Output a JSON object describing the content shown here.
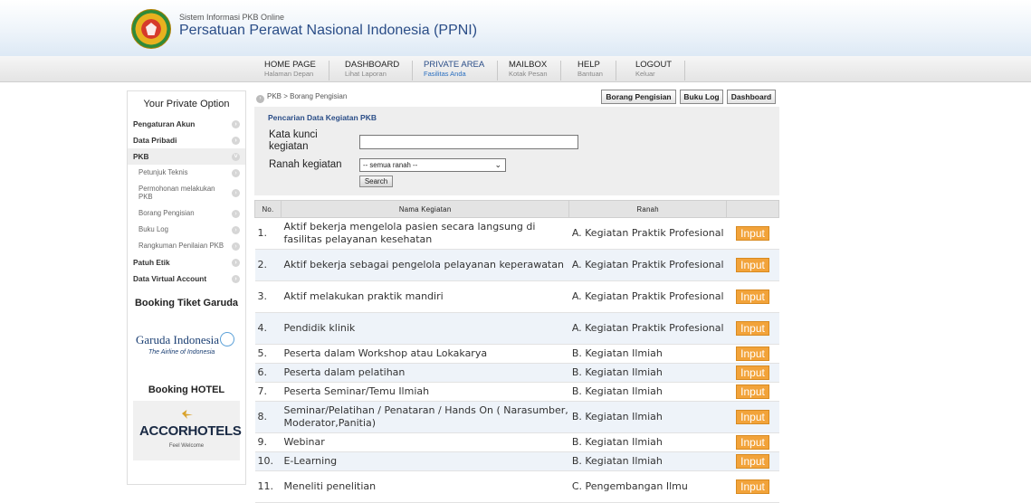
{
  "site": {
    "subtitle": "Sistem Informasi PKB Online",
    "title": "Persatuan Perawat Nasional Indonesia (PPNI)"
  },
  "nav": [
    {
      "label": "HOME PAGE",
      "sub": "Halaman Depan"
    },
    {
      "label": "DASHBOARD",
      "sub": "Lihat Laporan"
    },
    {
      "label": "PRIVATE AREA",
      "sub": "Fasilitas Anda",
      "active": true
    },
    {
      "label": "MAILBOX",
      "sub": "Kotak Pesan"
    },
    {
      "label": "HELP",
      "sub": "Bantuan"
    },
    {
      "label": "LOGOUT",
      "sub": "Keluar"
    }
  ],
  "sidebar": {
    "title": "Your Private Option",
    "items": [
      {
        "label": "Pengaturan Akun"
      },
      {
        "label": "Data Pribadi"
      },
      {
        "label": "PKB"
      },
      {
        "label": "Petunjuk Teknis"
      },
      {
        "label": "Permohonan melakukan PKB"
      },
      {
        "label": "Borang Pengisian"
      },
      {
        "label": "Buku Log"
      },
      {
        "label": "Rangkuman Penilaian PKB"
      },
      {
        "label": "Patuh Etik"
      },
      {
        "label": "Data Virtual Account"
      }
    ],
    "garuda_title": "Booking Tiket Garuda",
    "garuda_logo_text": "Garuda Indonesia",
    "garuda_logo_sub": "The Airline of Indonesia",
    "hotel_title": "Booking HOTEL",
    "accor_logo_text": "ACCORHOTELS",
    "accor_logo_sub": "Feel Welcome"
  },
  "breadcrumb": "PKB > Borang Pengisian",
  "top_buttons": {
    "borang": "Borang Pengisian",
    "bukulog": "Buku Log",
    "dashboard": "Dashboard"
  },
  "search": {
    "title": "Pencarian Data Kegiatan PKB",
    "keyword_label": "Kata kunci kegiatan",
    "keyword_value": "",
    "ranah_label": "Ranah kegiatan",
    "ranah_selected": "-- semua ranah --",
    "button": "Search"
  },
  "table": {
    "headers": [
      "No.",
      "Nama Kegiatan",
      "Ranah",
      ""
    ],
    "action_label": "Input",
    "rows": [
      {
        "no": "1.",
        "nama": "Aktif bekerja mengelola pasien secara langsung di fasilitas pelayanan kesehatan",
        "ranah": "A. Kegiatan Praktik Profesional"
      },
      {
        "no": "2.",
        "nama": "Aktif bekerja sebagai pengelola pelayanan keperawatan",
        "ranah": "A. Kegiatan Praktik Profesional"
      },
      {
        "no": "3.",
        "nama": "Aktif melakukan praktik mandiri",
        "ranah": "A. Kegiatan Praktik Profesional"
      },
      {
        "no": "4.",
        "nama": "Pendidik klinik",
        "ranah": "A. Kegiatan Praktik Profesional"
      },
      {
        "no": "5.",
        "nama": "Peserta dalam Workshop atau Lokakarya",
        "ranah": "B. Kegiatan Ilmiah"
      },
      {
        "no": "6.",
        "nama": "Peserta dalam pelatihan",
        "ranah": "B. Kegiatan Ilmiah"
      },
      {
        "no": "7.",
        "nama": "Peserta Seminar/Temu Ilmiah",
        "ranah": "B. Kegiatan Ilmiah"
      },
      {
        "no": "8.",
        "nama": "Seminar/Pelatihan / Penataran / Hands On ( Narasumber, Moderator,Panitia)",
        "ranah": "B. Kegiatan Ilmiah"
      },
      {
        "no": "9.",
        "nama": "Webinar",
        "ranah": "B. Kegiatan Ilmiah"
      },
      {
        "no": "10.",
        "nama": "E-Learning",
        "ranah": "B. Kegiatan Ilmiah"
      },
      {
        "no": "11.",
        "nama": "Meneliti penelitian",
        "ranah": "C. Pengembangan Ilmu"
      }
    ]
  }
}
